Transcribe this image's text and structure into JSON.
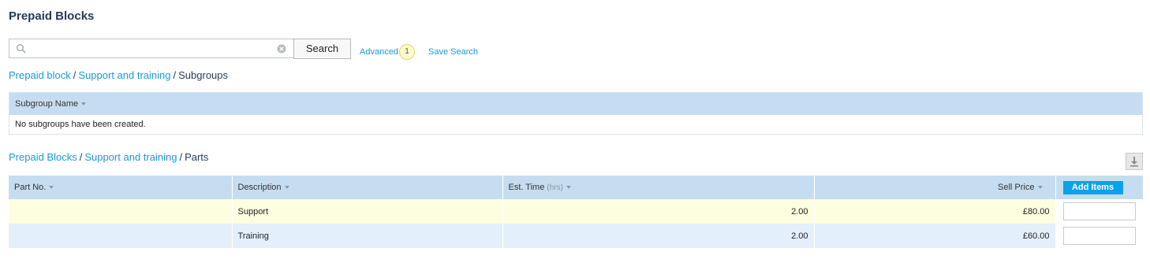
{
  "page": {
    "title": "Prepaid Blocks"
  },
  "search": {
    "placeholder": "",
    "value": "",
    "button_label": "Search",
    "advanced_label": "Advanced",
    "advanced_count": "1",
    "save_search_label": "Save Search"
  },
  "subgroups_breadcrumb": {
    "root": "Prepaid block",
    "sep1": "/",
    "middle": "Support and training",
    "sep2": "/",
    "current": "Subgroups"
  },
  "subgroups_table": {
    "column_header": "Subgroup Name",
    "empty_message": "No subgroups have been created."
  },
  "parts_breadcrumb": {
    "root": "Prepaid Blocks",
    "sep1": "/",
    "middle": "Support and training",
    "sep2": "/",
    "current": "Parts"
  },
  "parts_table": {
    "headers": {
      "part_no": "Part No.",
      "description": "Description",
      "est_time": "Est. Time",
      "est_time_hint": "(hrs)",
      "sell_price": "Sell Price",
      "add_items": "Add Items"
    },
    "rows": [
      {
        "part_no": "",
        "description": "Support",
        "est_time": "2.00",
        "sell_price": "£80.00",
        "qty": ""
      },
      {
        "part_no": "",
        "description": "Training",
        "est_time": "2.00",
        "sell_price": "£60.00",
        "qty": ""
      }
    ]
  },
  "icons": {
    "search": "magnifier-icon",
    "clear": "clear-circle-icon",
    "download": "download-icon",
    "sort": "sort-down-icon"
  },
  "colors": {
    "accent": "#1a9ad6",
    "header_bg": "#c6ddf1",
    "row_highlight": "#fdfde0",
    "row_alt": "#e3f0fb",
    "add_button": "#0aa3e8"
  }
}
